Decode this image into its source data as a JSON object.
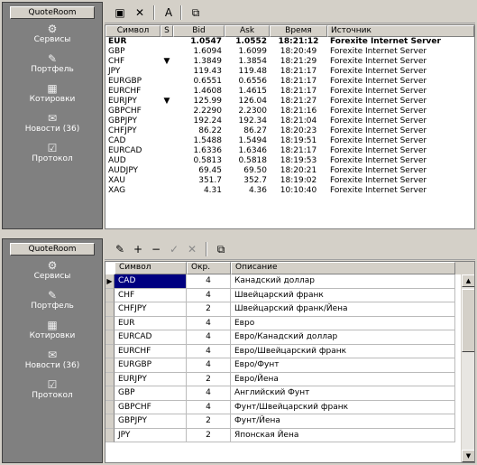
{
  "panel1": {
    "sidebar": {
      "title": "QuoteRoom",
      "items": [
        {
          "label": "Сервисы",
          "icon": "services-icon"
        },
        {
          "label": "Портфель",
          "icon": "portfolio-icon"
        },
        {
          "label": "Котировки",
          "icon": "quotes-icon"
        },
        {
          "label": "Новости (36)",
          "icon": "news-icon"
        },
        {
          "label": "Протокол",
          "icon": "log-icon"
        }
      ]
    },
    "columns": [
      "Символ",
      "Ѕ",
      "Bid",
      "Ask",
      "Время",
      "Источник"
    ],
    "rows": [
      {
        "symbol": "EUR",
        "arrow": "",
        "bid": "1.0547",
        "ask": "1.0552",
        "time": "18:21:12",
        "source": "Forexite Internet Server",
        "bold": true
      },
      {
        "symbol": "GBP",
        "arrow": "",
        "bid": "1.6094",
        "ask": "1.6099",
        "time": "18:20:49",
        "source": "Forexite Internet Server",
        "bold": false
      },
      {
        "symbol": "CHF",
        "arrow": "▼",
        "bid": "1.3849",
        "ask": "1.3854",
        "time": "18:21:29",
        "source": "Forexite Internet Server",
        "bold": false
      },
      {
        "symbol": "JPY",
        "arrow": "",
        "bid": "119.43",
        "ask": "119.48",
        "time": "18:21:17",
        "source": "Forexite Internet Server",
        "bold": false
      },
      {
        "symbol": "EURGBP",
        "arrow": "",
        "bid": "0.6551",
        "ask": "0.6556",
        "time": "18:21:17",
        "source": "Forexite Internet Server",
        "bold": false
      },
      {
        "symbol": "EURCHF",
        "arrow": "",
        "bid": "1.4608",
        "ask": "1.4615",
        "time": "18:21:17",
        "source": "Forexite Internet Server",
        "bold": false
      },
      {
        "symbol": "EURJPY",
        "arrow": "▼",
        "bid": "125.99",
        "ask": "126.04",
        "time": "18:21:27",
        "source": "Forexite Internet Server",
        "bold": false
      },
      {
        "symbol": "GBPCHF",
        "arrow": "",
        "bid": "2.2290",
        "ask": "2.2300",
        "time": "18:21:16",
        "source": "Forexite Internet Server",
        "bold": false
      },
      {
        "symbol": "GBPJPY",
        "arrow": "",
        "bid": "192.24",
        "ask": "192.34",
        "time": "18:21:04",
        "source": "Forexite Internet Server",
        "bold": false
      },
      {
        "symbol": "CHFJPY",
        "arrow": "",
        "bid": "86.22",
        "ask": "86.27",
        "time": "18:20:23",
        "source": "Forexite Internet Server",
        "bold": false
      },
      {
        "symbol": "CAD",
        "arrow": "",
        "bid": "1.5488",
        "ask": "1.5494",
        "time": "18:19:51",
        "source": "Forexite Internet Server",
        "bold": false
      },
      {
        "symbol": "EURCAD",
        "arrow": "",
        "bid": "1.6336",
        "ask": "1.6346",
        "time": "18:21:17",
        "source": "Forexite Internet Server",
        "bold": false
      },
      {
        "symbol": "AUD",
        "arrow": "",
        "bid": "0.5813",
        "ask": "0.5818",
        "time": "18:19:53",
        "source": "Forexite Internet Server",
        "bold": false
      },
      {
        "symbol": "AUDJPY",
        "arrow": "",
        "bid": "69.45",
        "ask": "69.50",
        "time": "18:20:21",
        "source": "Forexite Internet Server",
        "bold": false
      },
      {
        "symbol": "XAU",
        "arrow": "",
        "bid": "351.7",
        "ask": "352.7",
        "time": "18:19:02",
        "source": "Forexite Internet Server",
        "bold": false
      },
      {
        "symbol": "XAG",
        "arrow": "",
        "bid": "4.31",
        "ask": "4.36",
        "time": "10:10:40",
        "source": "Forexite Internet Server",
        "bold": false
      }
    ]
  },
  "panel2": {
    "sidebar": {
      "title": "QuoteRoom",
      "items": [
        {
          "label": "Сервисы",
          "icon": "services-icon"
        },
        {
          "label": "Портфель",
          "icon": "portfolio-icon"
        },
        {
          "label": "Котировки",
          "icon": "quotes-icon"
        },
        {
          "label": "Новости (36)",
          "icon": "news-icon"
        },
        {
          "label": "Протокол",
          "icon": "log-icon"
        }
      ]
    },
    "columns": [
      "Символ",
      "Окр.",
      "Описание"
    ],
    "rows": [
      {
        "symbol": "CAD",
        "round": "4",
        "desc": "Канадский доллар",
        "selected": true
      },
      {
        "symbol": "CHF",
        "round": "4",
        "desc": "Швейцарский франк",
        "selected": false
      },
      {
        "symbol": "CHFJPY",
        "round": "2",
        "desc": "Швейцарский франк/Йена",
        "selected": false
      },
      {
        "symbol": "EUR",
        "round": "4",
        "desc": "Евро",
        "selected": false
      },
      {
        "symbol": "EURCAD",
        "round": "4",
        "desc": "Евро/Канадский доллар",
        "selected": false
      },
      {
        "symbol": "EURCHF",
        "round": "4",
        "desc": "Евро/Швейцарский франк",
        "selected": false
      },
      {
        "symbol": "EURGBP",
        "round": "4",
        "desc": "Евро/Фунт",
        "selected": false
      },
      {
        "symbol": "EURJPY",
        "round": "2",
        "desc": "Евро/Йена",
        "selected": false
      },
      {
        "symbol": "GBP",
        "round": "4",
        "desc": "Английский Фунт",
        "selected": false
      },
      {
        "symbol": "GBPCHF",
        "round": "4",
        "desc": "Фунт/Швейцарский франк",
        "selected": false
      },
      {
        "symbol": "GBPJPY",
        "round": "2",
        "desc": "Фунт/Йена",
        "selected": false
      },
      {
        "symbol": "JPY",
        "round": "2",
        "desc": "Японская Йена",
        "selected": false
      }
    ]
  },
  "icons": {
    "services": "⚙",
    "portfolio": "✎",
    "quotes": "▦",
    "news": "✉",
    "log": "☑",
    "properties": "▣",
    "close": "✕",
    "font": "A",
    "windows": "⧉",
    "edit": "✎",
    "add": "+",
    "remove": "−",
    "apply": "✓",
    "cancel": "✕",
    "selected_marker": "▶"
  }
}
